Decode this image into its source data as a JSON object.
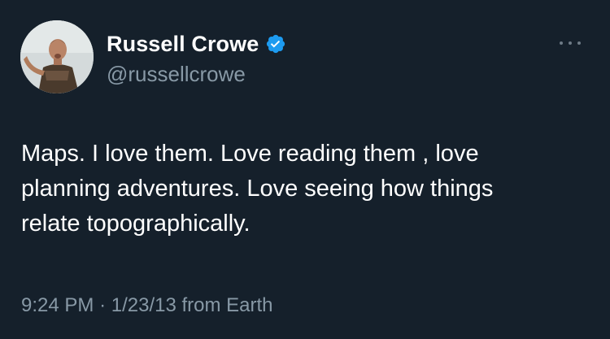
{
  "user": {
    "display_name": "Russell Crowe",
    "handle": "@russellcrowe",
    "verified": true
  },
  "tweet": {
    "lines": [
      "Maps. I love them. Love reading them , love",
      "planning adventures. Love seeing how things",
      "relate topographically."
    ],
    "time": "9:24 PM",
    "separator": "·",
    "date": "1/23/13",
    "source": "from Earth"
  },
  "icons": {
    "verified": "verified-badge-icon",
    "more": "more-options-icon"
  },
  "colors": {
    "background": "#15202b",
    "text": "#ffffff",
    "secondary_text": "#8899a6",
    "verified_blue": "#1d9bf0"
  }
}
